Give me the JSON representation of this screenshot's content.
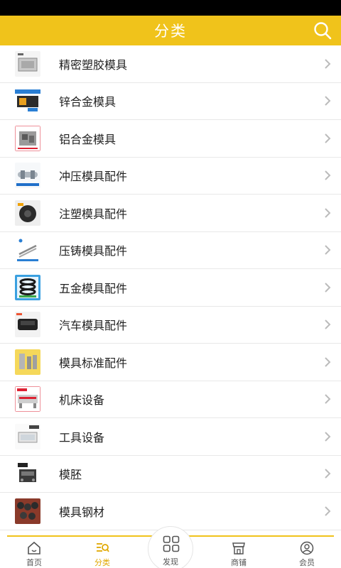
{
  "header": {
    "title": "分类"
  },
  "categories": [
    {
      "label": "精密塑胶模具",
      "thumb": "mold-block-image"
    },
    {
      "label": "锌合金模具",
      "thumb": "zinc-mold-image"
    },
    {
      "label": "铝合金模具",
      "thumb": "aluminum-mold-image"
    },
    {
      "label": "冲压模具配件",
      "thumb": "stamping-part-image"
    },
    {
      "label": "注塑模具配件",
      "thumb": "injection-part-image"
    },
    {
      "label": "压铸模具配件",
      "thumb": "diecast-pin-image"
    },
    {
      "label": "五金模具配件",
      "thumb": "spring-image"
    },
    {
      "label": "汽车模具配件",
      "thumb": "auto-part-image"
    },
    {
      "label": "模具标准配件",
      "thumb": "standard-part-image"
    },
    {
      "label": "机床设备",
      "thumb": "machine-image"
    },
    {
      "label": "工具设备",
      "thumb": "tool-equipment-image"
    },
    {
      "label": "模胚",
      "thumb": "mold-base-image"
    },
    {
      "label": "模具钢材",
      "thumb": "steel-image"
    }
  ],
  "tabs": {
    "home": "首页",
    "category": "分类",
    "discover": "发现",
    "shop": "商铺",
    "member": "会员"
  },
  "colors": {
    "accent": "#f0c31b",
    "active_tab": "#e0a800"
  }
}
